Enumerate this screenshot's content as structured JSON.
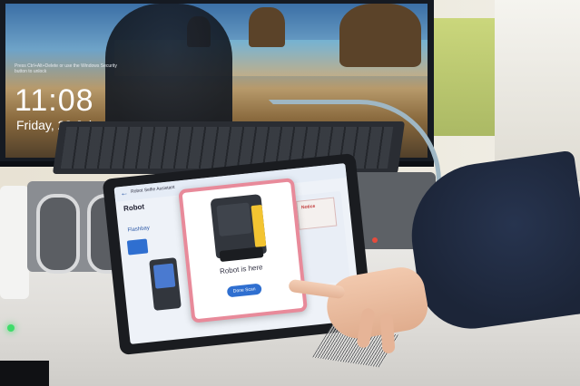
{
  "monitor": {
    "notice_text": "Press Ctrl+Alt+Delete or use the Windows Security button to unlock",
    "time": "11:08",
    "date": "Friday, 28 July"
  },
  "tablet": {
    "header_title": "Robot Selfie Assistant",
    "section_title": "Robot",
    "tab_label": "Flashbay",
    "modal": {
      "title": "Robot is here",
      "button_label": "Done Scan"
    },
    "notice_card_label": "Notice"
  },
  "colors": {
    "modal_border": "#e88a9a",
    "primary_button": "#2f6fd0",
    "robot_accent": "#f3c431",
    "status_led_green": "#3fdc6a",
    "status_led_red": "#e64b3c"
  },
  "icons": [
    "back-arrow-icon",
    "robot-icon"
  ]
}
